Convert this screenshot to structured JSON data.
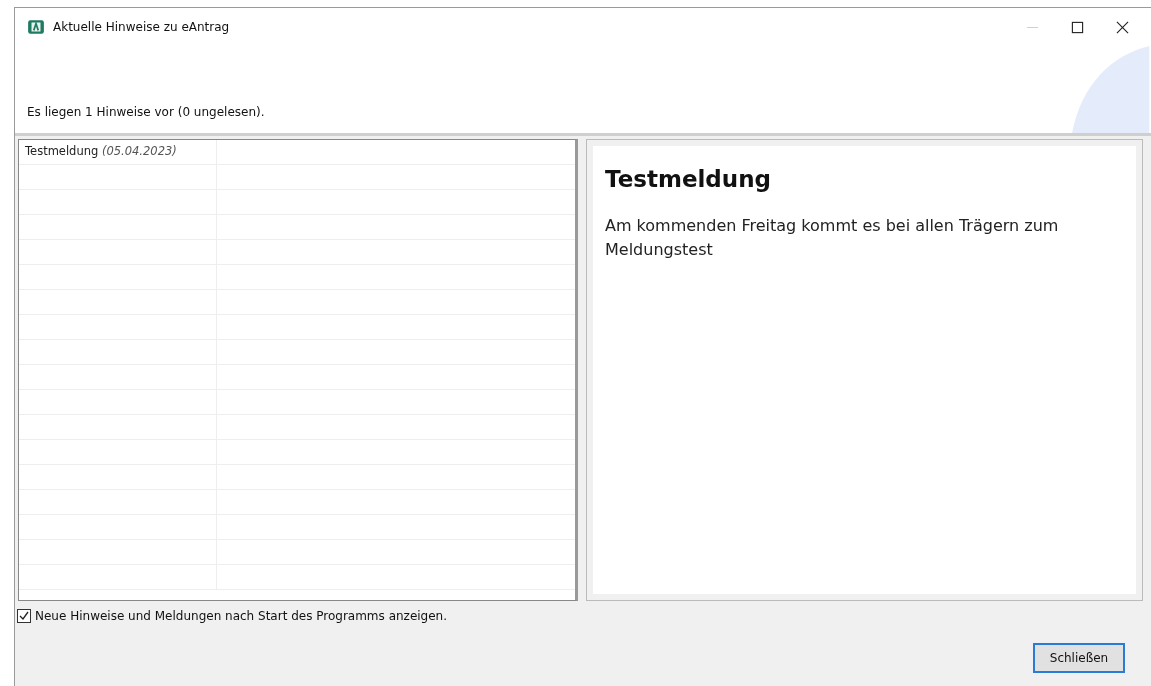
{
  "window": {
    "title": "Aktuelle Hinweise zu eAntrag"
  },
  "header": {
    "summary": "Es liegen 1 Hinweise vor (0 ungelesen)."
  },
  "messages": [
    {
      "title": "Testmeldung",
      "date": "(05.04.2023)"
    }
  ],
  "detail": {
    "title": "Testmeldung",
    "body": "Am kommenden Freitag kommt es bei allen Trägern zum Meldungstest"
  },
  "show_on_start": {
    "label": "Neue Hinweise und Meldungen nach Start des Programms anzeigen.",
    "checked": true
  },
  "buttons": [
    {
      "label": "Schließen"
    }
  ]
}
